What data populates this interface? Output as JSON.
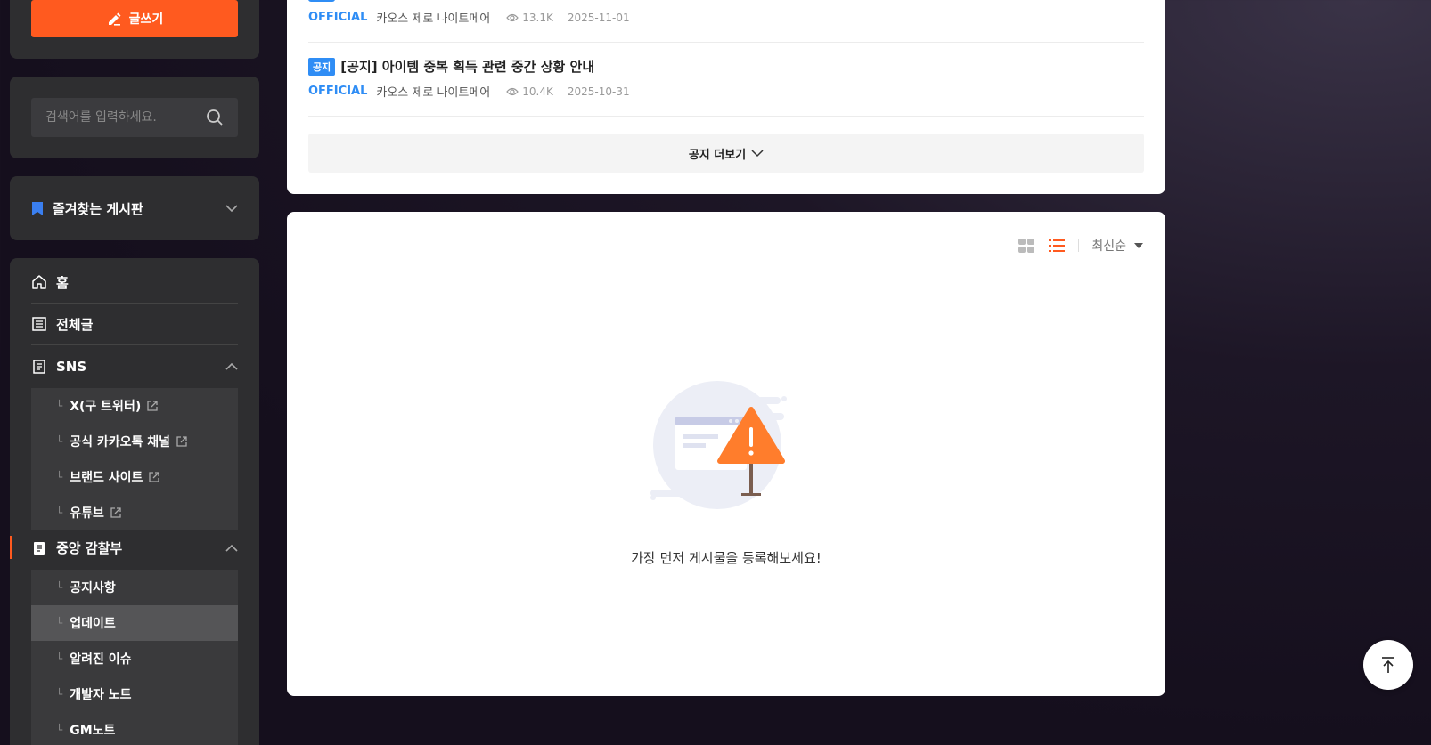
{
  "sidebar": {
    "write_label": "글쓰기",
    "search_placeholder": "검색어를 입력하세요.",
    "favorites_label": "즐겨찾는 게시판",
    "nav": {
      "home": "홈",
      "all_posts": "전체글",
      "sns": "SNS",
      "sns_items": [
        "X(구 트위터)",
        "공식 카카오톡 채널",
        "브랜드 사이트",
        "유튜브"
      ],
      "central": "중앙 감찰부",
      "central_items": [
        "공지사항",
        "업데이트",
        "알려진 이슈",
        "개발자 노트",
        "GM노트"
      ],
      "active_item": "업데이트"
    }
  },
  "notices": {
    "items": [
      {
        "official": "OFFICIAL",
        "author": "카오스 제로 나이트메어",
        "views": "13.1K",
        "date": "2025-11-01"
      },
      {
        "badge": "공지",
        "title": "[공지] 아이템 중복 획득 관련 중간 상황 안내",
        "official": "OFFICIAL",
        "author": "카오스 제로 나이트메어",
        "views": "10.4K",
        "date": "2025-10-31"
      }
    ],
    "more_label": "공지 더보기"
  },
  "posts": {
    "sort_label": "최신순",
    "empty_message": "가장 먼저 게시물을 등록해보세요!"
  },
  "colors": {
    "accent": "#ff5a1f",
    "official_blue": "#2f8df5",
    "sidebar_bg": "#2e2e30"
  }
}
